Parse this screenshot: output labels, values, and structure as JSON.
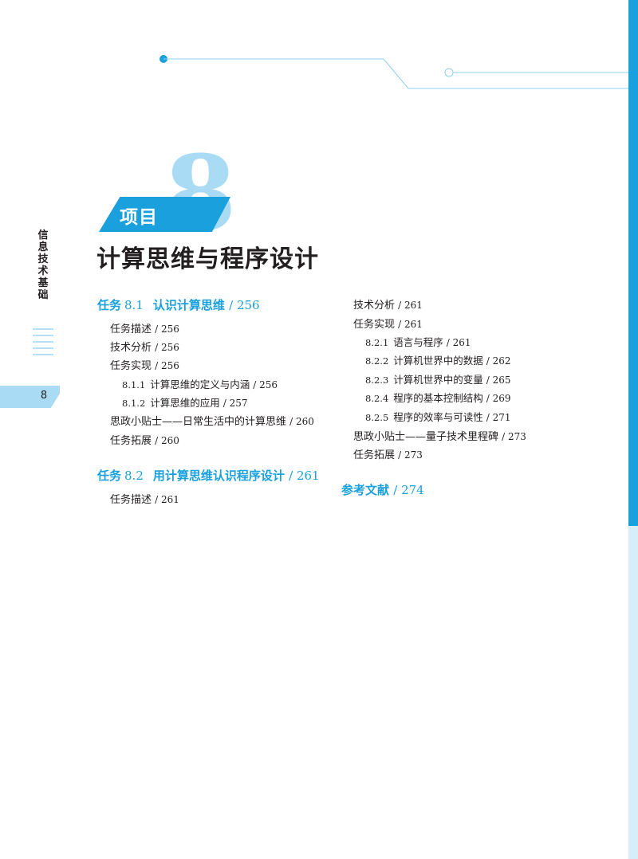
{
  "side": {
    "title": "信息技术基础",
    "page_number": "8"
  },
  "chapter": {
    "big_number": "8",
    "project_label": "项目",
    "title": "计算思维与程序设计"
  },
  "toc": {
    "task1": {
      "label": "任务",
      "num": "8.1",
      "title": "认识计算思维",
      "page": "/ 256"
    },
    "task1_items": [
      {
        "text": "任务描述",
        "page": "/ 256"
      },
      {
        "text": "技术分析",
        "page": "/ 256"
      },
      {
        "text": "任务实现",
        "page": "/ 256"
      }
    ],
    "task1_subs": [
      {
        "num": "8.1.1",
        "text": "计算思维的定义与内涵",
        "page": "/ 256"
      },
      {
        "num": "8.1.2",
        "text": "计算思维的应用",
        "page": "/ 257"
      }
    ],
    "task1_tail": [
      {
        "text": "思政小贴士——日常生活中的计算思维",
        "page": "/ 260"
      },
      {
        "text": "任务拓展",
        "page": "/ 260"
      }
    ],
    "task2": {
      "label": "任务",
      "num": "8.2",
      "title": "用计算思维认识程序设计",
      "page": "/ 261"
    },
    "task2_items_left": [
      {
        "text": "任务描述",
        "page": "/ 261"
      }
    ],
    "task2_items_right": [
      {
        "text": "技术分析",
        "page": "/ 261"
      },
      {
        "text": "任务实现",
        "page": "/ 261"
      }
    ],
    "task2_subs": [
      {
        "num": "8.2.1",
        "text": "语言与程序",
        "page": "/ 261"
      },
      {
        "num": "8.2.2",
        "text": "计算机世界中的数据",
        "page": "/ 262"
      },
      {
        "num": "8.2.3",
        "text": "计算机世界中的变量",
        "page": "/ 265"
      },
      {
        "num": "8.2.4",
        "text": "程序的基本控制结构",
        "page": "/ 269"
      },
      {
        "num": "8.2.5",
        "text": "程序的效率与可读性",
        "page": "/ 271"
      }
    ],
    "task2_tail": [
      {
        "text": "思政小贴士——量子技术里程碑",
        "page": "/ 273"
      },
      {
        "text": "任务拓展",
        "page": "/ 273"
      }
    ],
    "references": {
      "title": "参考文献",
      "page": "/ 274"
    }
  },
  "colors": {
    "accent": "#1aa0dc",
    "light_accent": "#a9dcf4",
    "pale_accent": "#d6eef9",
    "text": "#231f20"
  }
}
